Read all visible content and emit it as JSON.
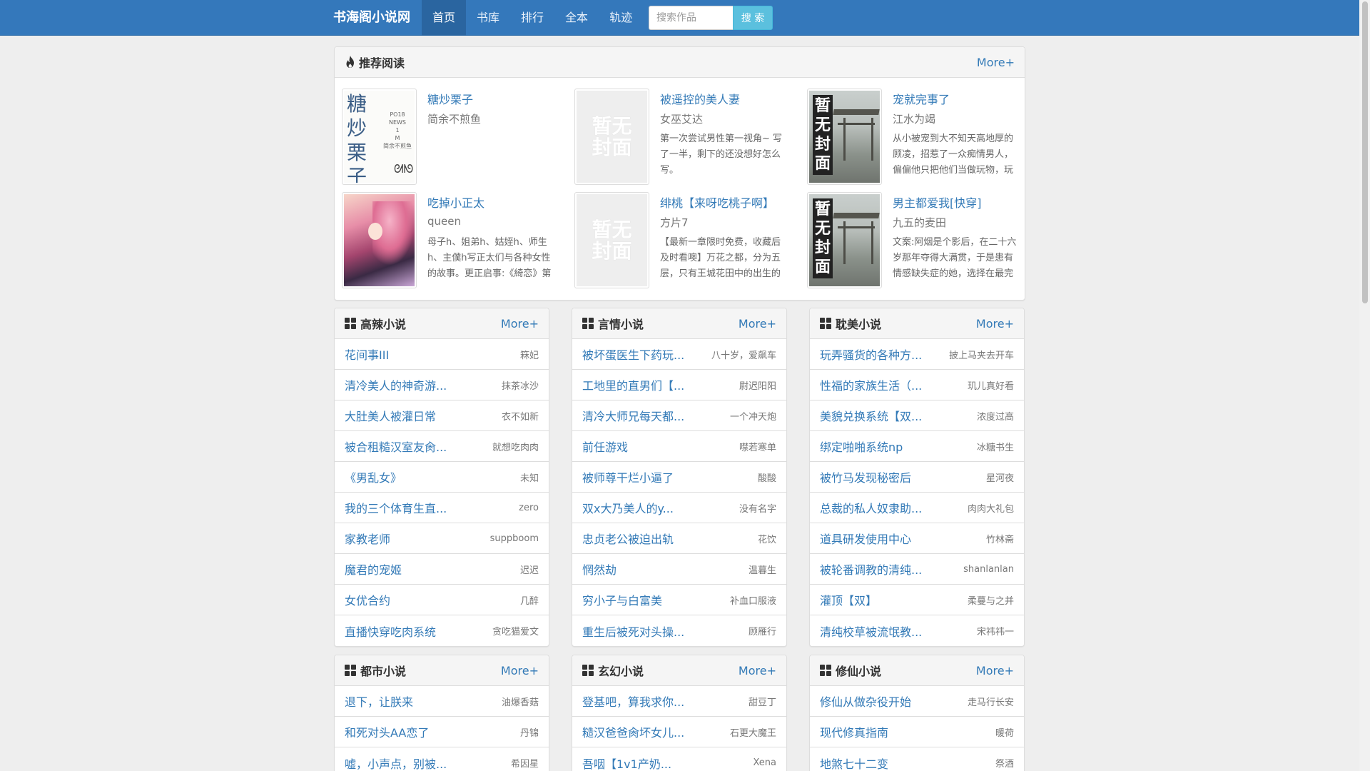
{
  "nav": {
    "brand": "书海阁小说网",
    "items": [
      {
        "label": "首页",
        "active": true
      },
      {
        "label": "书库",
        "active": false
      },
      {
        "label": "排行",
        "active": false
      },
      {
        "label": "全本",
        "active": false
      },
      {
        "label": "轨迹",
        "active": false
      }
    ],
    "search_placeholder": "搜索作品",
    "search_button": "搜 索"
  },
  "recommend": {
    "title": "推荐阅读",
    "more": "More+",
    "cover_none_text": "暂无封面",
    "cover_none_vertical": "暂无封面",
    "candy_cover_text": "糖炒栗子",
    "candy_cover_small": "PO18 NEWS 1 M 简余不煎鱼",
    "items": [
      {
        "title": "糖炒栗子",
        "author": "简余不煎鱼",
        "desc": "",
        "cover": "candy"
      },
      {
        "title": "被遥控的美人妻",
        "author": "女巫艾达",
        "desc": "第一次尝试男性第一视角~ 写了一半，剩下的还没想好怎么写。",
        "cover": "none"
      },
      {
        "title": "宠就完事了",
        "author": "江水为竭",
        "desc": "从小被宠到大不知天高地厚的顾凌，招惹了一众痴情男人，偏偏他只把他们当做玩物，玩",
        "cover": "photo"
      },
      {
        "title": "吃掉小正太",
        "author": "queen",
        "desc": "母子h、姐弟h、姑姪h、师生h、主僕h写正太们与各种女性的故事。更正启事:《綺恋》第",
        "cover": "anime"
      },
      {
        "title": "绯桃【来呀吃桃子啊】",
        "author": "方片7",
        "desc": "【最新一章限时免费，收藏后及时看噢】万花之都，分为五层，只有王城花田中的出生的",
        "cover": "none"
      },
      {
        "title": "男主都爱我[快穿]",
        "author": "九五的麦田",
        "desc": "文案:阿烟是个影后，在二十六岁那年夺得大满贯，于是患有情感缺失症的她，选择在最完",
        "cover": "photo"
      }
    ]
  },
  "categories": [
    {
      "title": "高辣小说",
      "more": "More+",
      "rows": [
        {
          "title": "花间事III",
          "author": "箖妃"
        },
        {
          "title": "清冷美人的神奇游...",
          "author": "抹茶冰沙"
        },
        {
          "title": "大肚美人被灌日常",
          "author": "衣不如新"
        },
        {
          "title": "被合租糙汉室友肏...",
          "author": "就想吃肉肉"
        },
        {
          "title": "《男乱女》",
          "author": "未知"
        },
        {
          "title": "我的三个体育生直...",
          "author": "zero"
        },
        {
          "title": "家教老师",
          "author": "suppboom"
        },
        {
          "title": "魔君的宠姬",
          "author": "迟迟"
        },
        {
          "title": "女优合约",
          "author": "几醉"
        },
        {
          "title": "直播快穿吃肉系统",
          "author": "贪吃猫爱文"
        }
      ]
    },
    {
      "title": "言情小说",
      "more": "More+",
      "rows": [
        {
          "title": "被坏蛋医生下药玩...",
          "author": "八十岁，爱飙车"
        },
        {
          "title": "工地里的直男们【...",
          "author": "尉迟阳阳"
        },
        {
          "title": "清冷大师兄每天都...",
          "author": "一个冲天炮"
        },
        {
          "title": "前任游戏",
          "author": "噤若寒单"
        },
        {
          "title": "被师尊干烂小逼了",
          "author": "酸酸"
        },
        {
          "title": "双x大乃美人的y...",
          "author": "没有名字"
        },
        {
          "title": "忠贞老公被迫出轨",
          "author": "花饮"
        },
        {
          "title": "惘然劫",
          "author": "温暮生"
        },
        {
          "title": "穷小子与白富美",
          "author": "补血口服液"
        },
        {
          "title": "重生后被死对头操...",
          "author": "顾雁行"
        }
      ]
    },
    {
      "title": "耽美小说",
      "more": "More+",
      "rows": [
        {
          "title": "玩弄骚货的各种方...",
          "author": "披上马夹去开车"
        },
        {
          "title": "性福的家族生活（...",
          "author": "玑儿真好看"
        },
        {
          "title": "美貌兑换系统【双...",
          "author": "浓度过高"
        },
        {
          "title": "绑定啪啪系统np",
          "author": "冰糖书生"
        },
        {
          "title": "被竹马发现秘密后",
          "author": "星河夜"
        },
        {
          "title": "总裁的私人奴隶助...",
          "author": "肉肉大礼包"
        },
        {
          "title": "道具研发使用中心",
          "author": "竹林斋"
        },
        {
          "title": "被轮番调教的清纯...",
          "author": "shanlanlan"
        },
        {
          "title": "灌顶【双】",
          "author": "柔蔓与之并"
        },
        {
          "title": "清纯校草被流氓教...",
          "author": "宋祎祎一"
        }
      ]
    },
    {
      "title": "都市小说",
      "more": "More+",
      "rows": [
        {
          "title": "退下，让朕来",
          "author": "油爆香菇"
        },
        {
          "title": "和死对头AA恋了",
          "author": "丹锦"
        },
        {
          "title": "嘘，小声点，别被...",
          "author": "希因星"
        }
      ]
    },
    {
      "title": "玄幻小说",
      "more": "More+",
      "rows": [
        {
          "title": "登基吧，算我求你...",
          "author": "甜豆丁"
        },
        {
          "title": "糙汉爸爸肏坏女儿...",
          "author": "石更大魔王"
        },
        {
          "title": "吾咽【1v1产奶...",
          "author": "Xena"
        }
      ]
    },
    {
      "title": "修仙小说",
      "more": "More+",
      "rows": [
        {
          "title": "修仙从做杂役开始",
          "author": "走马行长安"
        },
        {
          "title": "现代修真指南",
          "author": "暖荷"
        },
        {
          "title": "地煞七十二变",
          "author": "祭酒"
        }
      ]
    }
  ]
}
